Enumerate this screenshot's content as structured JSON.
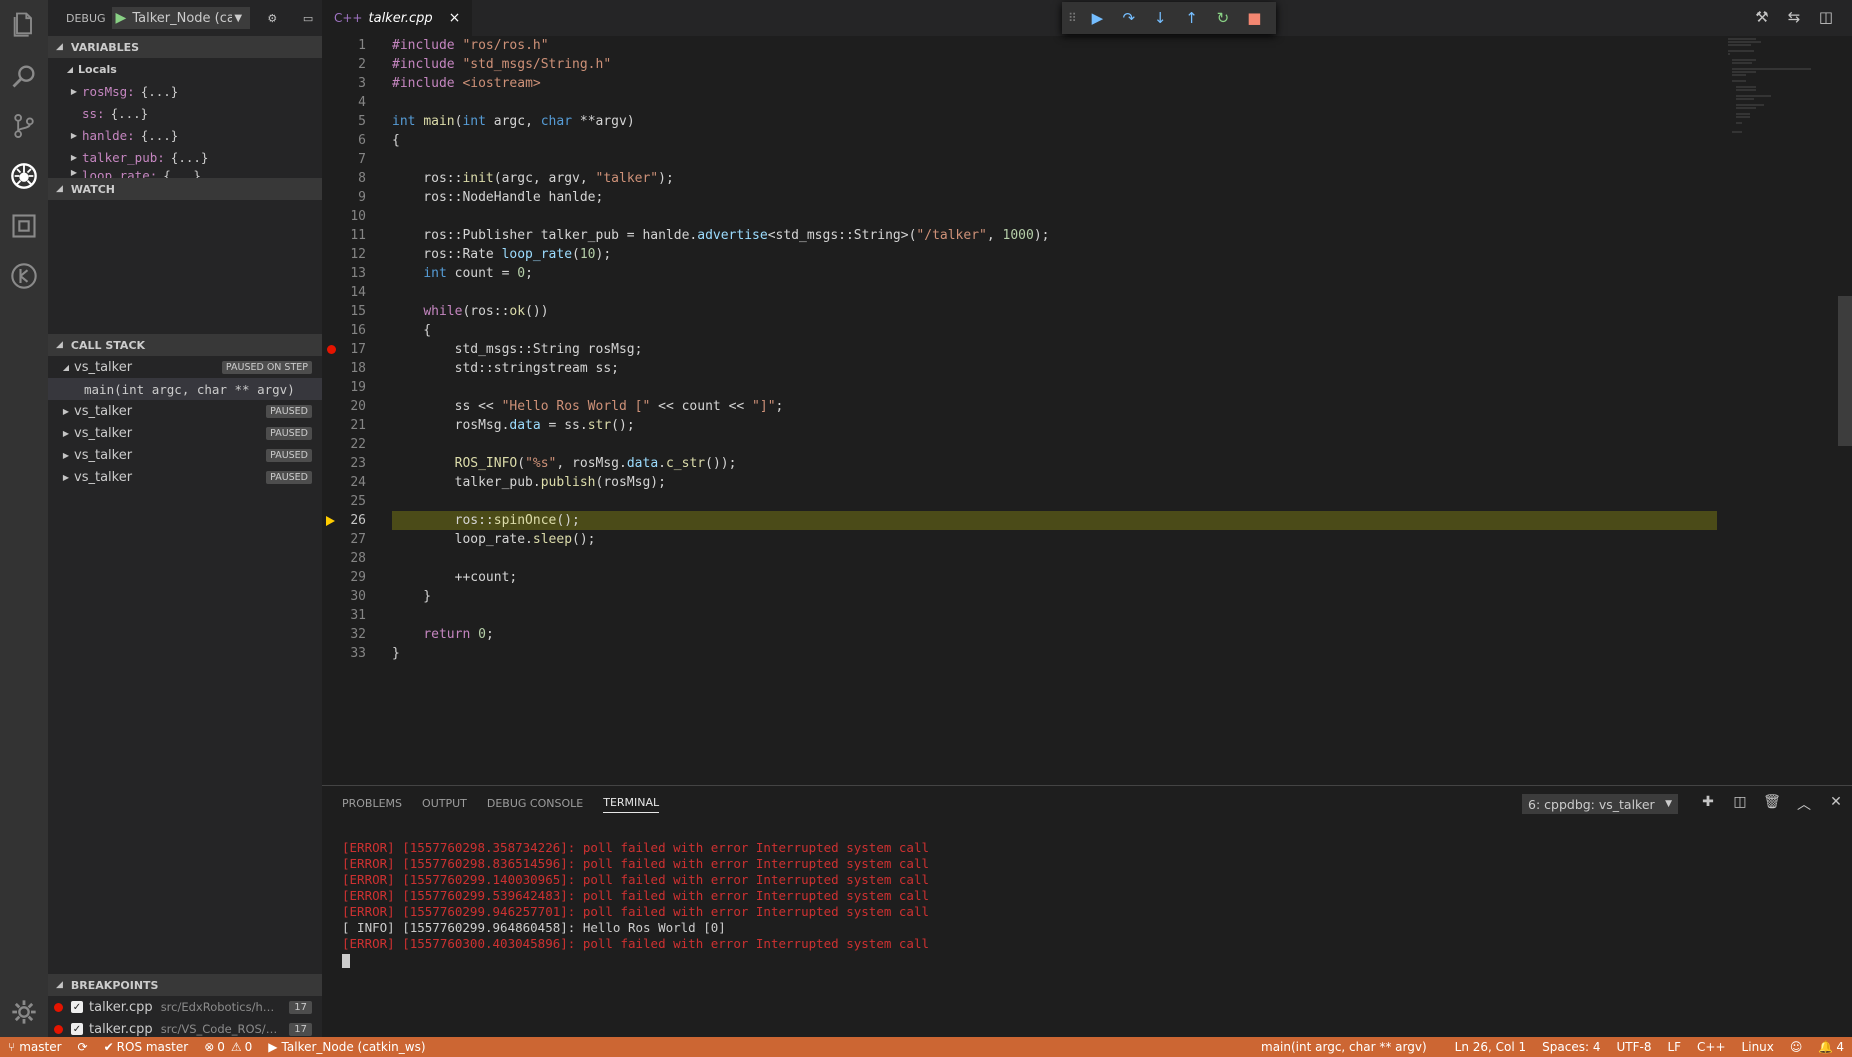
{
  "activity_bar": {
    "items": [
      "explorer-icon",
      "search-icon",
      "source-control-icon",
      "debug-icon",
      "extensions-icon",
      "ros-icon"
    ],
    "settings": "gear-icon"
  },
  "sidebar": {
    "debug_label": "DEBUG",
    "config_name": "Talker_Node (ca",
    "variables": {
      "title": "VARIABLES",
      "locals_label": "Locals",
      "items": [
        {
          "name": "rosMsg:",
          "value": "{...}"
        },
        {
          "name": "ss:",
          "value": "{...}"
        },
        {
          "name": "hanlde:",
          "value": "{...}"
        },
        {
          "name": "talker_pub:",
          "value": "{...}"
        },
        {
          "name": "loop_rate:",
          "value": "{...}"
        }
      ]
    },
    "watch": {
      "title": "WATCH"
    },
    "call_stack": {
      "title": "CALL STACK",
      "threads": [
        {
          "name": "vs_talker",
          "status": "PAUSED ON STEP",
          "frame": "main(int argc, char ** argv)"
        },
        {
          "name": "vs_talker",
          "status": "PAUSED"
        },
        {
          "name": "vs_talker",
          "status": "PAUSED"
        },
        {
          "name": "vs_talker",
          "status": "PAUSED"
        },
        {
          "name": "vs_talker",
          "status": "PAUSED"
        }
      ]
    },
    "breakpoints": {
      "title": "BREAKPOINTS",
      "items": [
        {
          "file": "talker.cpp",
          "path": "src/EdxRobotics/hell...",
          "line": "17"
        },
        {
          "file": "talker.cpp",
          "path": "src/VS_Code_ROS/he...",
          "line": "17"
        }
      ]
    }
  },
  "editor": {
    "tab_name": "talker.cpp",
    "breakpoint_line": 17,
    "current_line": 26,
    "line_numbers": [
      "1",
      "2",
      "3",
      "4",
      "5",
      "6",
      "7",
      "8",
      "9",
      "10",
      "11",
      "12",
      "13",
      "14",
      "15",
      "16",
      "17",
      "18",
      "19",
      "20",
      "21",
      "22",
      "23",
      "24",
      "25",
      "26",
      "27",
      "28",
      "29",
      "30",
      "31",
      "32",
      "33"
    ]
  },
  "panel": {
    "tabs": [
      "PROBLEMS",
      "OUTPUT",
      "DEBUG CONSOLE",
      "TERMINAL"
    ],
    "active_tab": "TERMINAL",
    "terminal_select": "6: cppdbg: vs_talker",
    "terminal_lines": [
      {
        "kind": "err",
        "text": "[ERROR] [1557760298.358734226]: poll failed with error Interrupted system call"
      },
      {
        "kind": "err",
        "text": "[ERROR] [1557760298.836514596]: poll failed with error Interrupted system call"
      },
      {
        "kind": "err",
        "text": "[ERROR] [1557760299.140030965]: poll failed with error Interrupted system call"
      },
      {
        "kind": "err",
        "text": "[ERROR] [1557760299.539642483]: poll failed with error Interrupted system call"
      },
      {
        "kind": "err",
        "text": "[ERROR] [1557760299.946257701]: poll failed with error Interrupted system call"
      },
      {
        "kind": "info",
        "text": "[ INFO] [1557760299.964860458]: Hello Ros World [0]"
      },
      {
        "kind": "err",
        "text": "[ERROR] [1557760300.403045896]: poll failed with error Interrupted system call"
      }
    ]
  },
  "statusbar": {
    "branch": "master",
    "ros": "ROS master",
    "errors": "0",
    "warnings": "0",
    "launch": "Talker_Node (catkin_ws)",
    "function": "main(int argc, char ** argv)",
    "position": "Ln 26, Col 1",
    "spaces": "Spaces: 4",
    "encoding": "UTF-8",
    "eol": "LF",
    "language": "C++",
    "os": "Linux",
    "notifications": "4",
    "color": "#cc6633"
  }
}
